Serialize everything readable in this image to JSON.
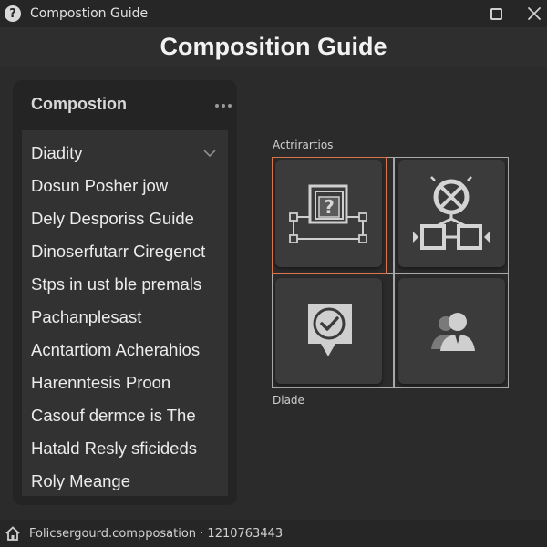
{
  "window": {
    "title": "Compostion Guide",
    "app_icon_glyph": "?",
    "icons": {
      "app": "help-icon",
      "maximize": "maximize-icon",
      "close": "close-icon"
    }
  },
  "header": {
    "title": "Composition Guide"
  },
  "panel": {
    "title": "Compostion",
    "menu_icon": "more-horizontal-icon",
    "items": [
      {
        "label": "Diadity"
      },
      {
        "label": "Dosun Posher jow"
      },
      {
        "label": "Dely Desporiss Guide"
      },
      {
        "label": "Dinoserfutarr Ciregenct"
      },
      {
        "label": "Stps in ust ble premals"
      },
      {
        "label": "Pachanplesast"
      },
      {
        "label": "Acntartiom Acherahios"
      },
      {
        "label": "Harenntesis Proon"
      },
      {
        "label": "Casouf dermce is The"
      },
      {
        "label": "Hatald Resly sficideds"
      },
      {
        "label": "Roly Meange"
      }
    ]
  },
  "grid": {
    "top_label": "Actrirartios",
    "bottom_label": "Diade",
    "selected_color": "#d9754a",
    "tiles": [
      {
        "icon": "frame-question-icon",
        "selected": true
      },
      {
        "icon": "connection-diagram-icon",
        "selected": false
      },
      {
        "icon": "checkmark-badge-icon",
        "selected": false
      },
      {
        "icon": "users-icon",
        "selected": false
      }
    ]
  },
  "status": {
    "text": "Folicsergourd.compposation · 1210763443",
    "icon": "home-icon"
  }
}
